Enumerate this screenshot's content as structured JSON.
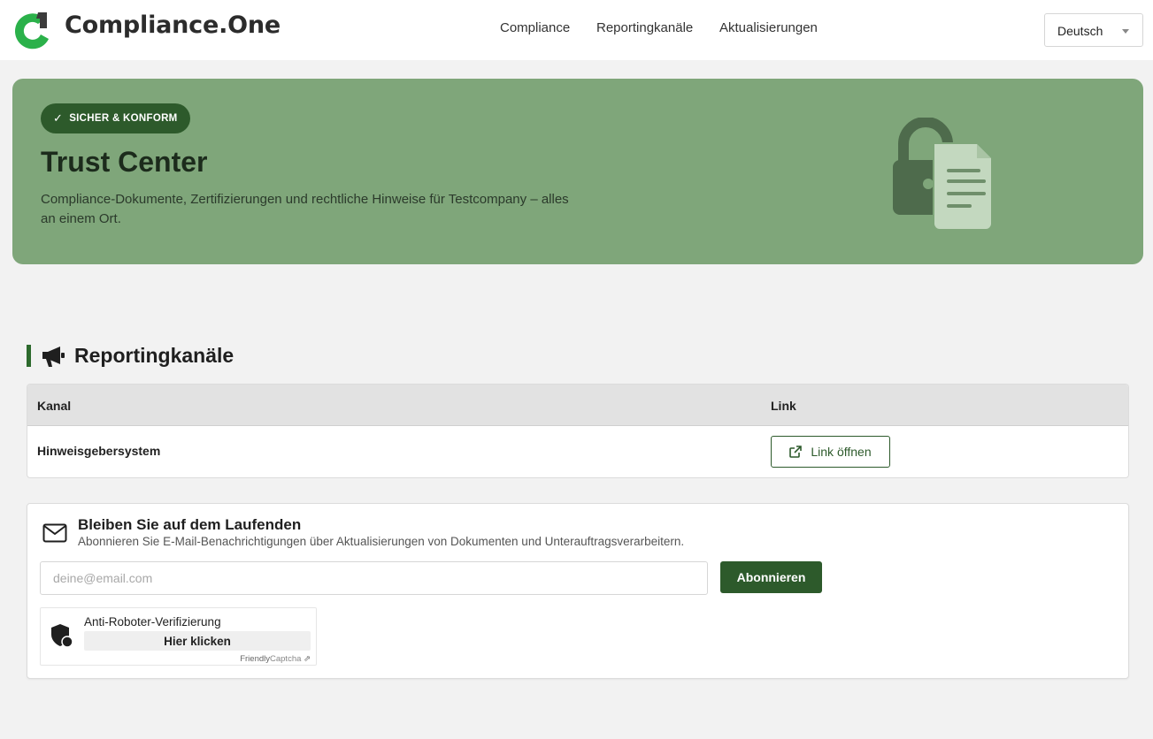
{
  "header": {
    "brand": "Compliance.One",
    "nav": [
      "Compliance",
      "Reportingkanäle",
      "Aktualisierungen"
    ],
    "language": "Deutsch"
  },
  "hero": {
    "badge": "SICHER & KONFORM",
    "title": "Trust Center",
    "subtitle": "Compliance-Dokumente, Zertifizierungen und rechtliche Hinweise für Testcompany – alles an einem Ort."
  },
  "reporting": {
    "title": "Reportingkanäle",
    "columns": [
      "Kanal",
      "Link"
    ],
    "rows": [
      {
        "channel": "Hinweisgebersystem",
        "link_label": "Link öffnen"
      }
    ]
  },
  "subscribe": {
    "title": "Bleiben Sie auf dem Laufenden",
    "description": "Abonnieren Sie E-Mail-Benachrichtigungen über Aktualisierungen von Dokumenten und Unterauftragsverarbeitern.",
    "email_placeholder": "deine@email.com",
    "button": "Abonnieren"
  },
  "captcha": {
    "label": "Anti-Roboter-Verifizierung",
    "button": "Hier klicken",
    "brand_a": "Friendly",
    "brand_b": "Captcha"
  },
  "colors": {
    "brand_green": "#2d5a2b",
    "hero_bg": "#7fa67a",
    "logo_green": "#2bb14a"
  }
}
